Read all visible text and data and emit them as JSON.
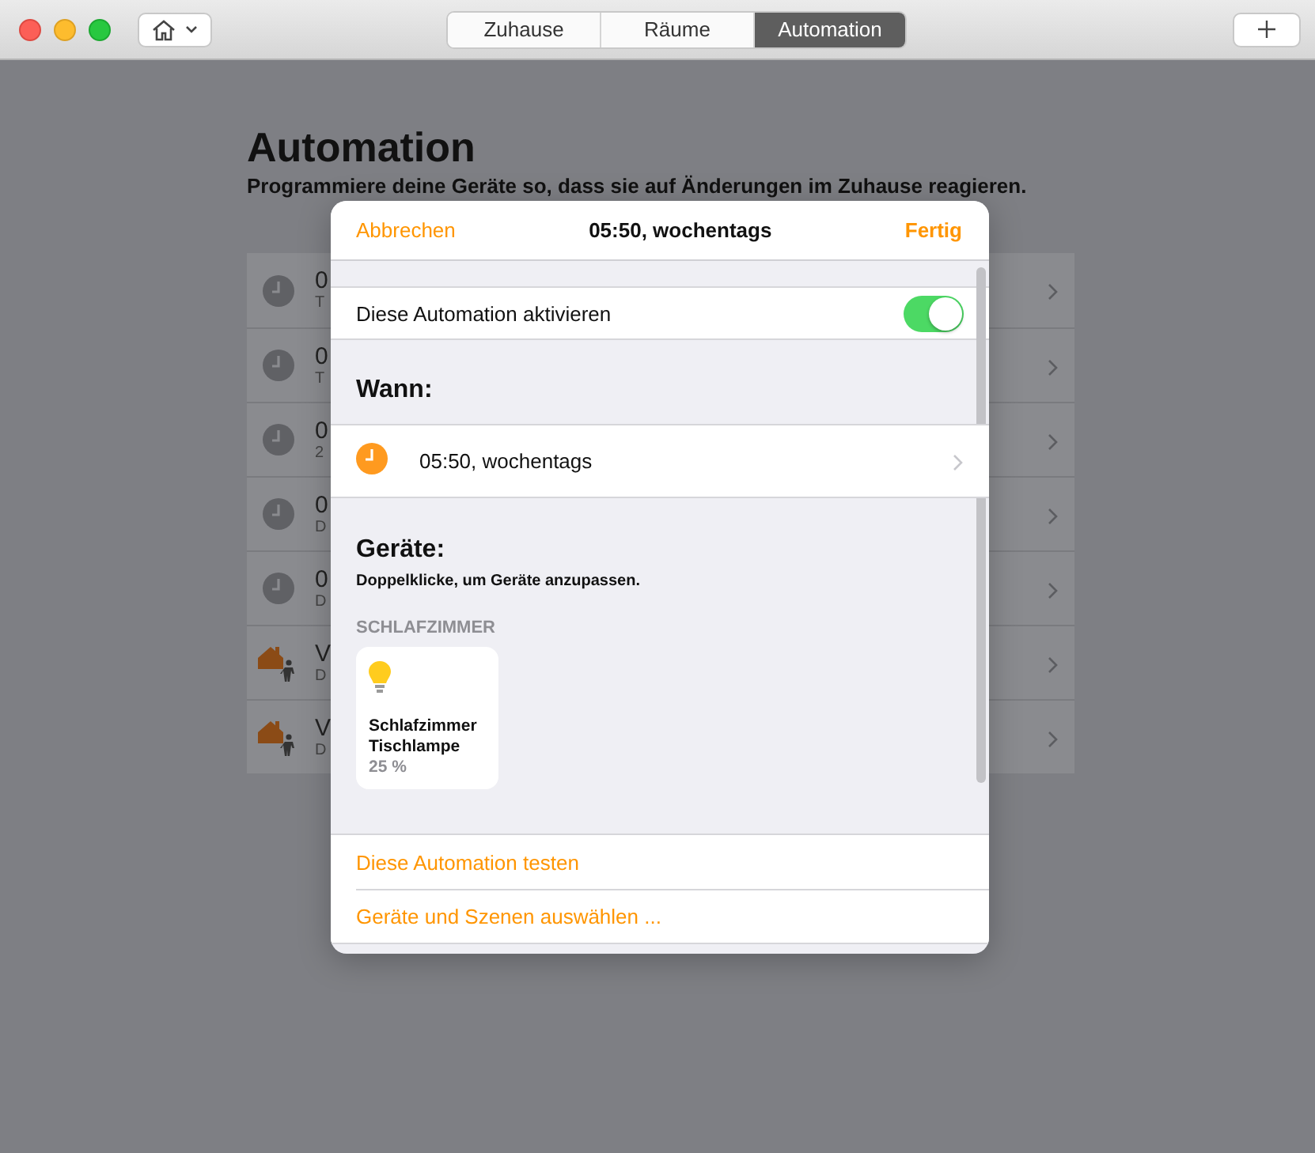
{
  "toolbar": {
    "segments": [
      {
        "label": "Zuhause",
        "selected": false
      },
      {
        "label": "Räume",
        "selected": false
      },
      {
        "label": "Automation",
        "selected": true
      }
    ]
  },
  "page": {
    "title": "Automation",
    "subtitle": "Programmiere deine Geräte so, dass sie auf Änderungen im Zuhause reagieren.",
    "automations": [
      {
        "kind": "timer",
        "title": "0",
        "subtitle": "T"
      },
      {
        "kind": "timer",
        "title": "0",
        "subtitle": "T"
      },
      {
        "kind": "timer",
        "title": "0",
        "subtitle": "2"
      },
      {
        "kind": "timer",
        "title": "0",
        "subtitle": "D"
      },
      {
        "kind": "timer",
        "title": "0",
        "subtitle": "D"
      },
      {
        "kind": "presence",
        "title": "V",
        "subtitle": "D"
      },
      {
        "kind": "presence",
        "title": "V",
        "subtitle": "D"
      }
    ]
  },
  "sheet": {
    "cancel": "Abbrechen",
    "title": "05:50, wochentags",
    "done": "Fertig",
    "enable": {
      "label": "Diese Automation aktivieren",
      "on": true
    },
    "when": {
      "heading": "Wann:",
      "trigger": {
        "kind": "timer",
        "label": "05:50, wochentags"
      }
    },
    "devices": {
      "heading": "Geräte:",
      "hint": "Doppelklicke, um Geräte anzupassen.",
      "rooms": [
        {
          "name": "SCHLAFZIMMER",
          "accessories": [
            {
              "kind": "light",
              "name": "Schlafzimmer Tischlampe",
              "status": "25 %"
            }
          ]
        }
      ]
    },
    "actions": [
      "Diese Automation testen",
      "Geräte und Szenen auswählen ..."
    ]
  }
}
